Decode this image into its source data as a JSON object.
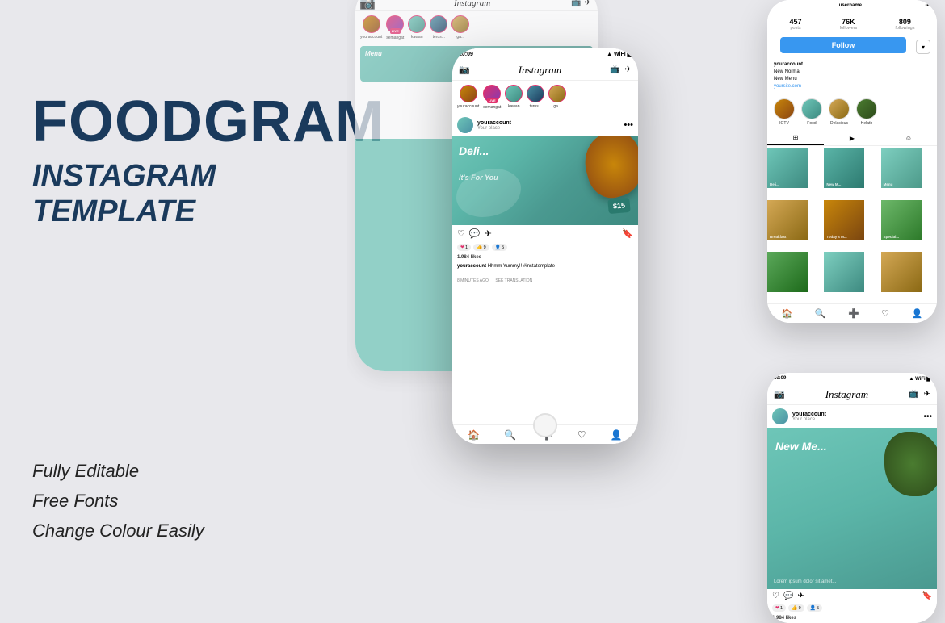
{
  "brand": {
    "title": "FOODGRAM",
    "subtitle_line1": "INSTAGRAM",
    "subtitle_line2": "TEMPLATE"
  },
  "features": {
    "item1": "Fully Editable",
    "item2": "Free Fonts",
    "item3": "Change Colour Easily"
  },
  "instagram": {
    "status_time": "20:09",
    "app_name": "Instagram",
    "username": "youraccount",
    "location": "Your place",
    "profile_username": "username",
    "posts_count": "457",
    "followers_count": "76K",
    "following_count": "809",
    "posts_label": "posts",
    "followers_label": "followers",
    "following_label": "followings",
    "follow_button": "Follow",
    "bio_name": "youraccount",
    "bio_line1": "New Normal",
    "bio_line2": "New Menu",
    "bio_site": "yoursite.com",
    "post_text": "Deli...",
    "post_subtitle": "It's For You",
    "post_price": "$15",
    "post_caption": "Lorem ipsum dolor sit amet, consectetur adipiscing elit, sed do eiusmod tempor incididunt ut labore et dolore magna aliqua",
    "likes_count": "1.984 likes",
    "comment_user": "youraccount",
    "comment_text": "Hhmm Yummy!! #instatemplate",
    "see_translation": "SEE TRANSLATION",
    "minutes_ago": "8 MINUTES AGO",
    "new_menu_title": "New Me...",
    "stories": [
      {
        "label": "youraccount",
        "live": false
      },
      {
        "label": "semangat",
        "live": true
      },
      {
        "label": "kawan",
        "live": false
      },
      {
        "label": "terusberjuang",
        "live": false
      },
      {
        "label": "ga...",
        "live": false
      }
    ],
    "highlights": [
      "IGTV",
      "Food",
      "Delacious",
      "Helath"
    ],
    "tabs": [
      "grid",
      "reels",
      "tagged"
    ]
  }
}
